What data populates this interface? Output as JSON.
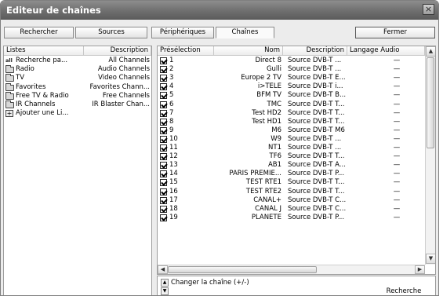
{
  "window": {
    "title": "Editeur de chaînes",
    "close_glyph": "×"
  },
  "tabs": [
    {
      "label": "Rechercher"
    },
    {
      "label": "Sources"
    },
    {
      "label": "Périphériques"
    },
    {
      "label": "Chaînes",
      "active": true
    }
  ],
  "close_button_label": "Fermer",
  "lists_panel": {
    "headers": {
      "name": "Listes",
      "description": "Description"
    },
    "items": [
      {
        "name": "Recherche pa...",
        "description": "All Channels",
        "icon": "all-icon"
      },
      {
        "name": "Radio",
        "description": "Audio Channels",
        "icon": "folder-icon"
      },
      {
        "name": "TV",
        "description": "Video Channels",
        "icon": "folder-icon"
      },
      {
        "name": "Favorites",
        "description": "Favorites Chann...",
        "icon": "folder-icon"
      },
      {
        "name": "Free TV & Radio",
        "description": "Free Channels",
        "icon": "folder-icon"
      },
      {
        "name": "IR Channels",
        "description": "IR Blaster Chan...",
        "icon": "folder-icon"
      },
      {
        "name": "Ajouter une Li...",
        "description": "",
        "icon": "add-list-icon"
      }
    ]
  },
  "channels_panel": {
    "headers": {
      "preset": "Présélection",
      "name": "Nom",
      "description": "Description",
      "audio": "Langage Audio"
    },
    "rows": [
      {
        "preset": "1",
        "name": "Direct 8",
        "description": "Source DVB-T ...",
        "audio": "—",
        "checked": true
      },
      {
        "preset": "2",
        "name": "Gulli",
        "description": "Source DVB-T ...",
        "audio": "—",
        "checked": true
      },
      {
        "preset": "3",
        "name": "Europe 2 TV",
        "description": "Source DVB-T E...",
        "audio": "—",
        "checked": true
      },
      {
        "preset": "4",
        "name": "i>TELE",
        "description": "Source DVB-T i...",
        "audio": "—",
        "checked": true
      },
      {
        "preset": "5",
        "name": "BFM TV",
        "description": "Source DVB-T B...",
        "audio": "—",
        "checked": true
      },
      {
        "preset": "6",
        "name": "TMC",
        "description": "Source DVB-T T...",
        "audio": "—",
        "checked": true
      },
      {
        "preset": "7",
        "name": "Test HD2",
        "description": "Source DVB-T T...",
        "audio": "—",
        "checked": true
      },
      {
        "preset": "8",
        "name": "Test HD1",
        "description": "Source DVB-T T...",
        "audio": "—",
        "checked": true
      },
      {
        "preset": "9",
        "name": "M6",
        "description": "Source DVB-T M6",
        "audio": "—",
        "checked": true
      },
      {
        "preset": "10",
        "name": "W9",
        "description": "Source DVB-T ...",
        "audio": "—",
        "checked": true
      },
      {
        "preset": "11",
        "name": "NT1",
        "description": "Source DVB-T ...",
        "audio": "—",
        "checked": true
      },
      {
        "preset": "12",
        "name": "TF6",
        "description": "Source DVB-T T...",
        "audio": "—",
        "checked": true
      },
      {
        "preset": "13",
        "name": "AB1",
        "description": "Source DVB-T A...",
        "audio": "—",
        "checked": true
      },
      {
        "preset": "14",
        "name": "PARIS PREMIE...",
        "description": "Source DVB-T P...",
        "audio": "—",
        "checked": true
      },
      {
        "preset": "15",
        "name": "TEST RTE1",
        "description": "Source DVB-T T...",
        "audio": "—",
        "checked": true
      },
      {
        "preset": "16",
        "name": "TEST RTE2",
        "description": "Source DVB-T T...",
        "audio": "—",
        "checked": true
      },
      {
        "preset": "17",
        "name": "CANAL+",
        "description": "Source DVB-T C...",
        "audio": "—",
        "checked": true
      },
      {
        "preset": "18",
        "name": "CANAL J",
        "description": "Source DVB-T C...",
        "audio": "—",
        "checked": true
      },
      {
        "preset": "19",
        "name": "PLANETE",
        "description": "Source DVB-T P...",
        "audio": "—",
        "checked": true
      }
    ],
    "scroll_up_glyph": "▲",
    "scroll_down_glyph": "▼",
    "scroll_left_glyph": "◀",
    "scroll_right_glyph": "▶"
  },
  "bottom": {
    "change_label": "Changer la chaîne (+/-)",
    "search_button": "Recherche",
    "spin_up_glyph": "▲",
    "spin_down_glyph": "▼"
  }
}
